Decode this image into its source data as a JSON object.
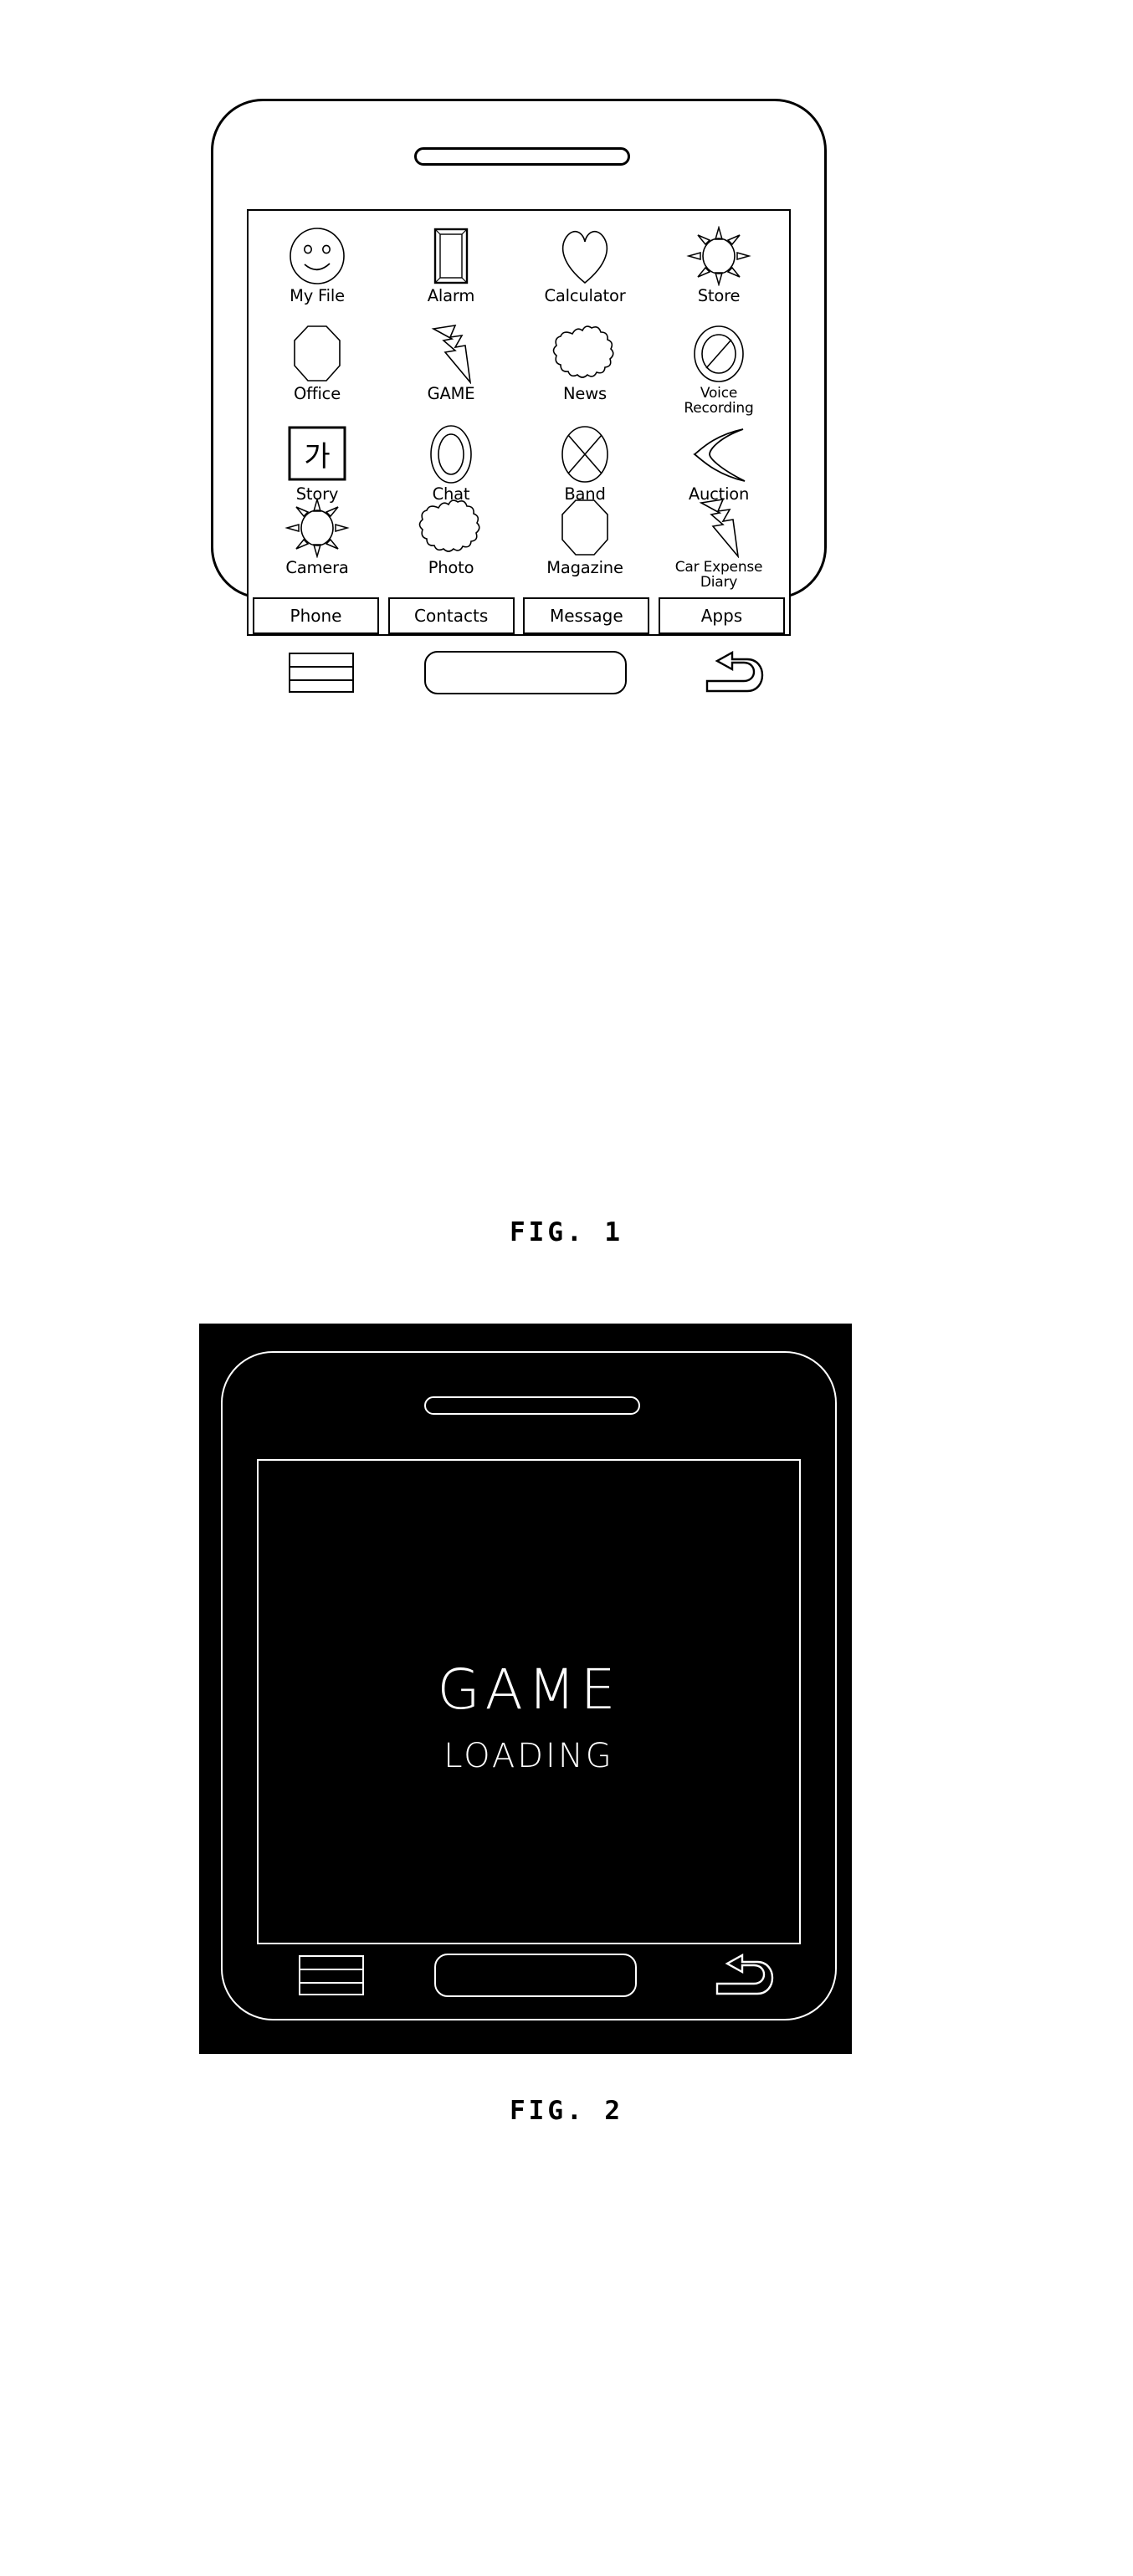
{
  "figures": [
    {
      "id": "fig-1",
      "caption": "FIG. 1",
      "device": {
        "screen": {
          "app_grid": {
            "rows": [
              [
                {
                  "label": "My File",
                  "icon": "smiley-face-icon"
                },
                {
                  "label": "Alarm",
                  "icon": "picture-frame-icon"
                },
                {
                  "label": "Calculator",
                  "icon": "heart-icon"
                },
                {
                  "label": "Store",
                  "icon": "sun-icon"
                }
              ],
              [
                {
                  "label": "Office",
                  "icon": "octagon-icon"
                },
                {
                  "label": "GAME",
                  "icon": "lightning-bolt-icon"
                },
                {
                  "label": "News",
                  "icon": "cloud-icon"
                },
                {
                  "label": "Voice\nRecording",
                  "icon": "no-entry-circle-icon"
                }
              ],
              [
                {
                  "label": "Story",
                  "icon": "hangul-ga-square-icon",
                  "icon_text": "가"
                },
                {
                  "label": "Chat",
                  "icon": "double-ellipse-icon"
                },
                {
                  "label": "Band",
                  "icon": "crossed-circle-icon"
                },
                {
                  "label": "Auction",
                  "icon": "crescent-icon"
                }
              ],
              [
                {
                  "label": "Camera",
                  "icon": "sun-icon"
                },
                {
                  "label": "Photo",
                  "icon": "cloud-icon"
                },
                {
                  "label": "Magazine",
                  "icon": "octagon-icon"
                },
                {
                  "label": "Car Expense\nDiary",
                  "icon": "lightning-bolt-icon"
                }
              ]
            ]
          },
          "dock": [
            {
              "label": "Phone"
            },
            {
              "label": "Contacts"
            },
            {
              "label": "Message"
            },
            {
              "label": "Apps"
            }
          ]
        },
        "hardware_keys": [
          {
            "name": "menu-key",
            "icon": "menu-bars-icon"
          },
          {
            "name": "home-key",
            "icon": "home-rounded-rect-icon"
          },
          {
            "name": "back-key",
            "icon": "back-arrow-icon"
          }
        ],
        "speaker": {
          "icon": "speaker-grille-icon"
        }
      }
    },
    {
      "id": "fig-2",
      "caption": "FIG. 2",
      "background_color": "#000000",
      "device": {
        "screen": {
          "title": "GAME",
          "status": "LOADING"
        },
        "hardware_keys": [
          {
            "name": "menu-key",
            "icon": "menu-bars-icon"
          },
          {
            "name": "home-key",
            "icon": "home-rounded-rect-icon"
          },
          {
            "name": "back-key",
            "icon": "back-arrow-icon"
          }
        ],
        "speaker": {
          "icon": "speaker-grille-icon"
        }
      }
    }
  ],
  "colors": {
    "line": "#000000",
    "paper": "#ffffff",
    "inverted_line": "#ffffff"
  }
}
